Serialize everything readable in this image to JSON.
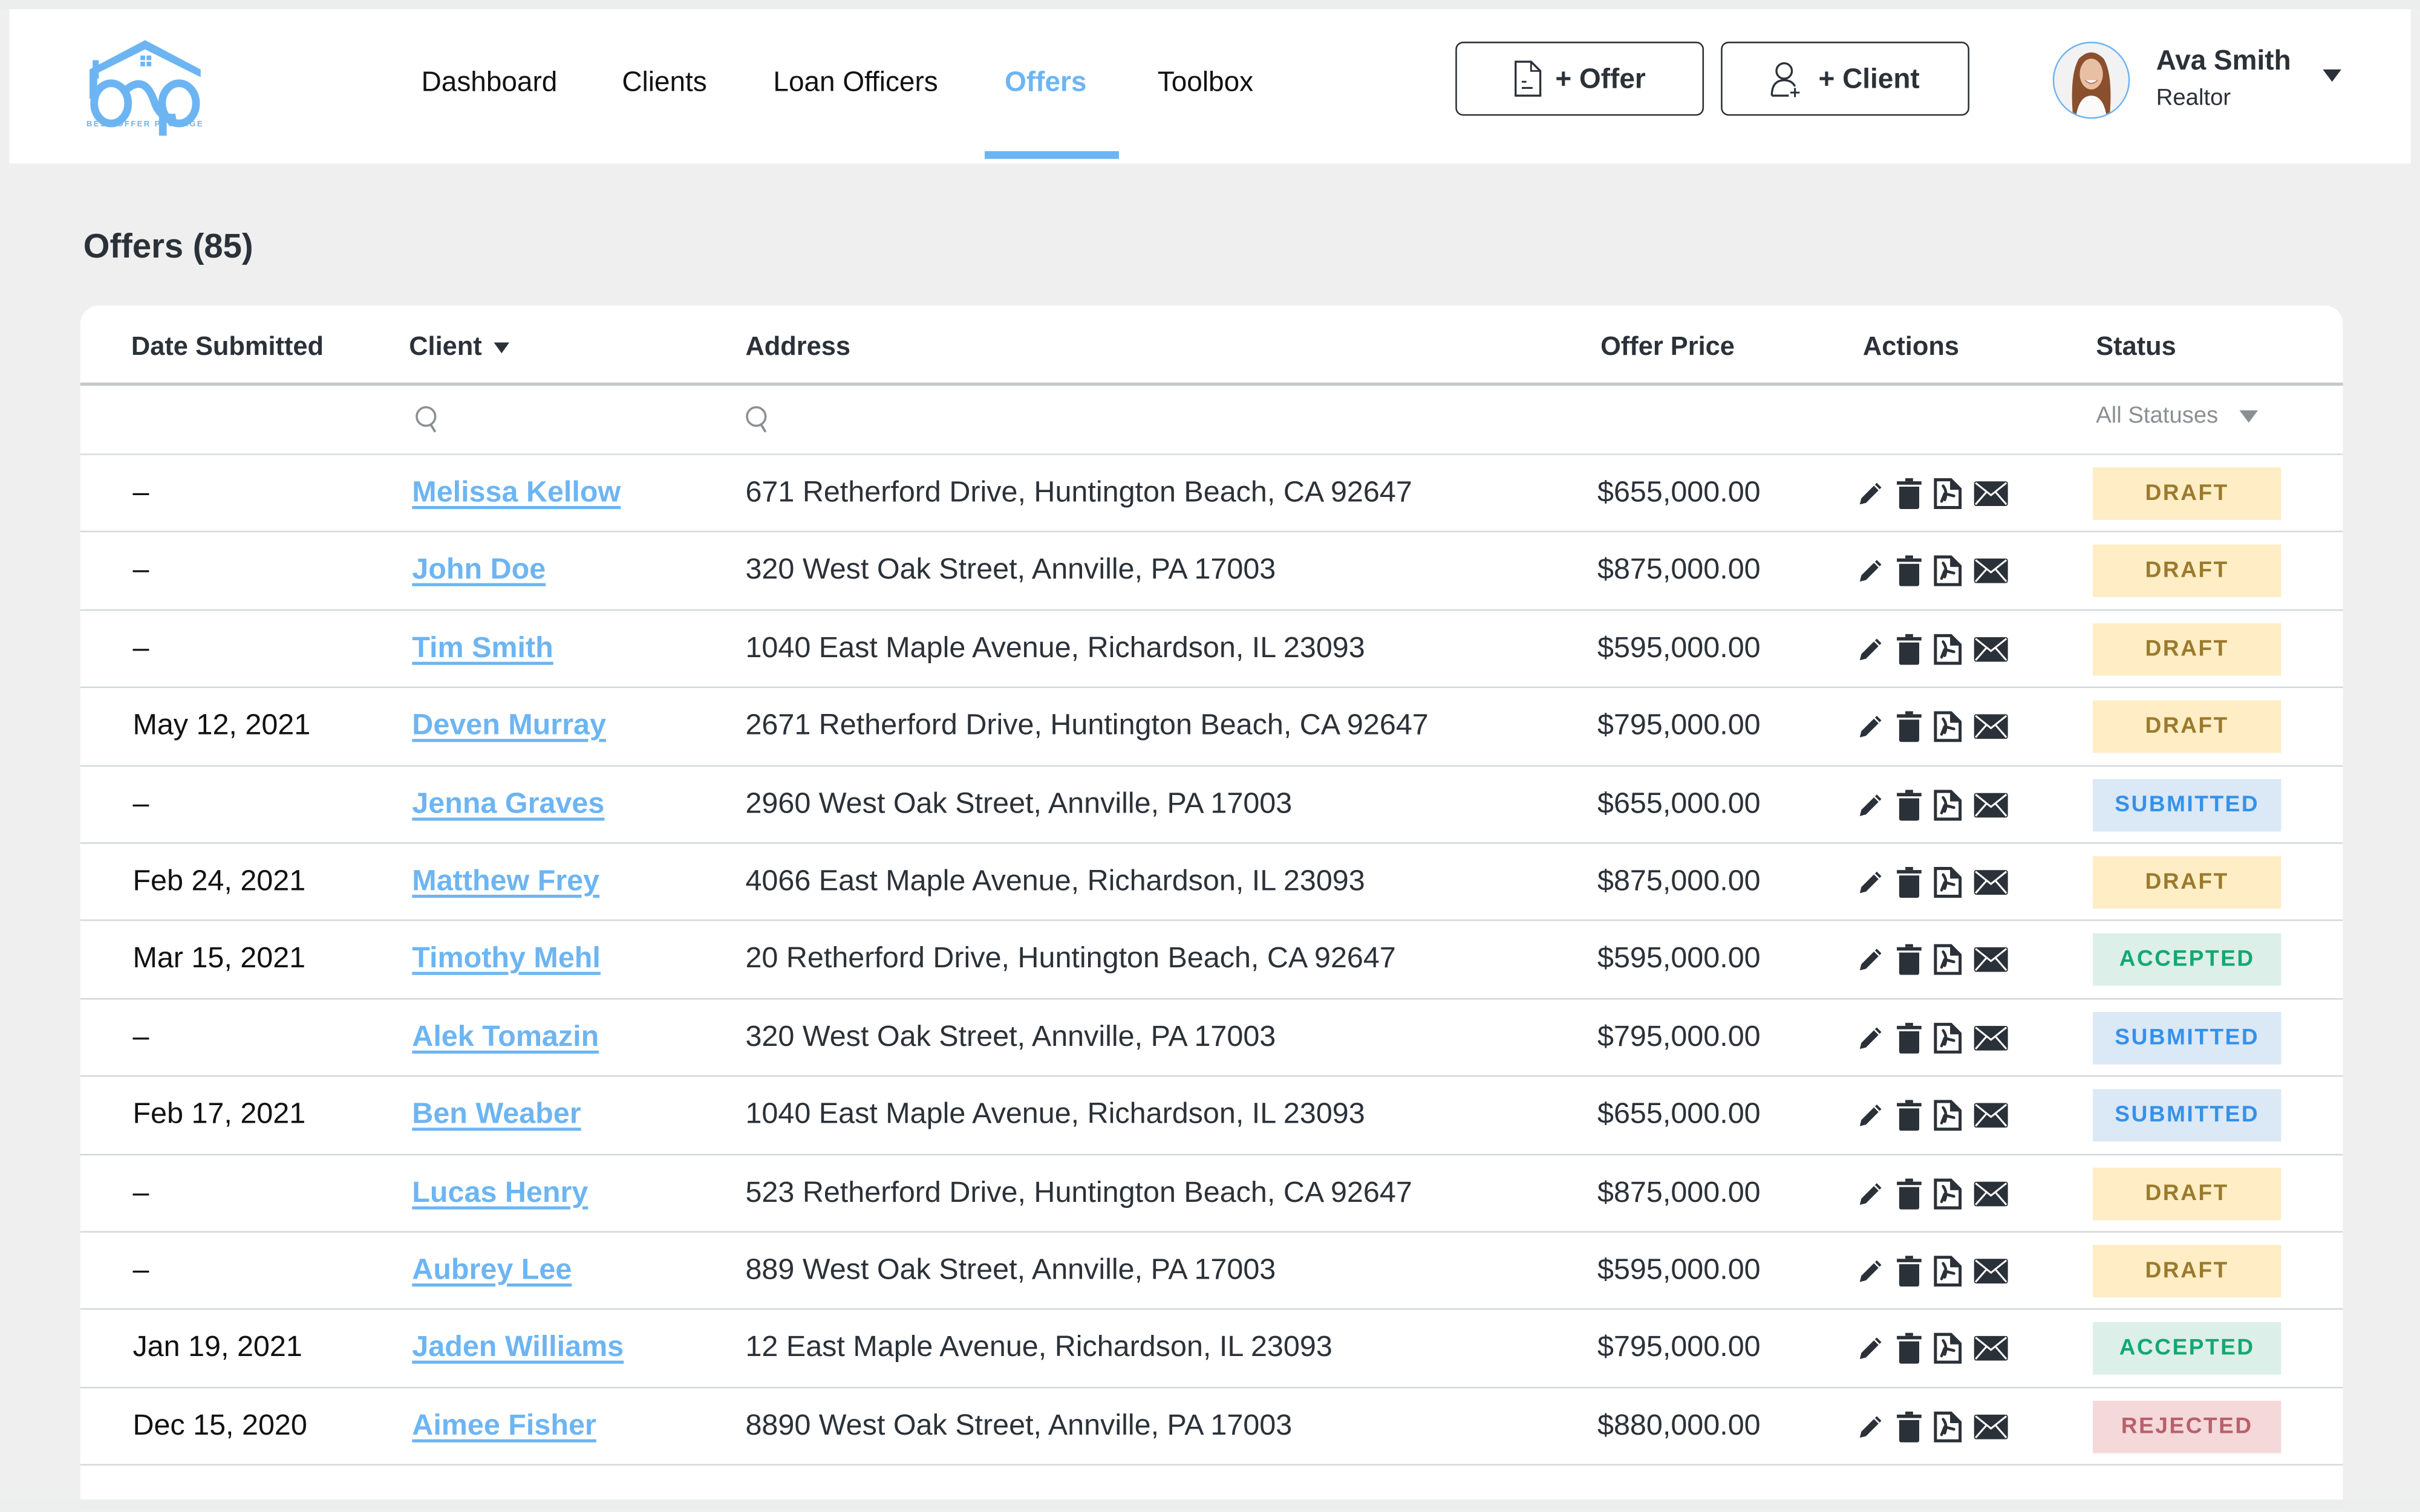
{
  "brand": {
    "logo_letters": "bop",
    "tagline": "BEST OFFER PACKAGE",
    "accent_color": "#6db5f2"
  },
  "nav": {
    "items": [
      {
        "label": "Dashboard",
        "active": false
      },
      {
        "label": "Clients",
        "active": false
      },
      {
        "label": "Loan Officers",
        "active": false
      },
      {
        "label": "Offers",
        "active": true
      },
      {
        "label": "Toolbox",
        "active": false
      }
    ]
  },
  "header_actions": {
    "add_offer": {
      "label": "+ Offer",
      "icon": "document-icon"
    },
    "add_client": {
      "label": "+ Client",
      "icon": "user-plus-icon"
    }
  },
  "user": {
    "name": "Ava Smith",
    "role": "Realtor",
    "avatar": "user-avatar-photo"
  },
  "page": {
    "title": "Offers (85)"
  },
  "table": {
    "columns": {
      "date": "Date Submitted",
      "client": "Client",
      "address": "Address",
      "price": "Offer Price",
      "actions": "Actions",
      "status": "Status"
    },
    "filters": {
      "client_search_placeholder": "",
      "address_search_placeholder": "",
      "status_selected": "All Statuses"
    },
    "action_icons": [
      "pencil-icon",
      "trash-icon",
      "pdf-icon",
      "envelope-icon"
    ],
    "status_styles": {
      "DRAFT": {
        "bg": "#feedc5",
        "fg": "#9b7a2c"
      },
      "SUBMITTED": {
        "bg": "#dbe8f5",
        "fg": "#3491ea"
      },
      "ACCEPTED": {
        "bg": "#dcefe8",
        "fg": "#13a872"
      },
      "REJECTED": {
        "bg": "#f5d8da",
        "fg": "#b8606b"
      }
    },
    "rows": [
      {
        "date": "–",
        "client": "Melissa Kellow",
        "address": "671 Retherford Drive, Huntington Beach, CA 92647",
        "price": "$655,000.00",
        "status": "DRAFT"
      },
      {
        "date": "–",
        "client": "John Doe",
        "address": "320 West Oak Street, Annville, PA 17003",
        "price": "$875,000.00",
        "status": "DRAFT"
      },
      {
        "date": "–",
        "client": "Tim Smith",
        "address": "1040 East Maple Avenue, Richardson, IL 23093",
        "price": "$595,000.00",
        "status": "DRAFT"
      },
      {
        "date": "May 12, 2021",
        "client": "Deven Murray",
        "address": "2671 Retherford Drive, Huntington Beach, CA 92647",
        "price": "$795,000.00",
        "status": "DRAFT"
      },
      {
        "date": "–",
        "client": "Jenna Graves",
        "address": "2960 West Oak Street, Annville, PA 17003",
        "price": "$655,000.00",
        "status": "SUBMITTED"
      },
      {
        "date": "Feb 24, 2021",
        "client": "Matthew Frey",
        "address": "4066 East Maple Avenue, Richardson, IL 23093",
        "price": "$875,000.00",
        "status": "DRAFT"
      },
      {
        "date": "Mar 15, 2021",
        "client": "Timothy Mehl",
        "address": "20 Retherford Drive, Huntington Beach, CA 92647",
        "price": "$595,000.00",
        "status": "ACCEPTED"
      },
      {
        "date": "–",
        "client": "Alek Tomazin",
        "address": "320 West Oak Street, Annville, PA 17003",
        "price": "$795,000.00",
        "status": "SUBMITTED"
      },
      {
        "date": "Feb 17, 2021",
        "client": "Ben Weaber",
        "address": "1040 East Maple Avenue, Richardson, IL 23093",
        "price": "$655,000.00",
        "status": "SUBMITTED"
      },
      {
        "date": "–",
        "client": "Lucas Henry",
        "address": "523 Retherford Drive, Huntington Beach, CA 92647",
        "price": "$875,000.00",
        "status": "DRAFT"
      },
      {
        "date": "–",
        "client": "Aubrey Lee",
        "address": "889 West Oak Street, Annville, PA 17003",
        "price": "$595,000.00",
        "status": "DRAFT"
      },
      {
        "date": "Jan 19, 2021",
        "client": "Jaden Williams",
        "address": "12 East Maple Avenue, Richardson, IL 23093",
        "price": "$795,000.00",
        "status": "ACCEPTED"
      },
      {
        "date": "Dec 15, 2020",
        "client": "Aimee Fisher",
        "address": "8890 West Oak Street, Annville, PA 17003",
        "price": "$880,000.00",
        "status": "REJECTED"
      }
    ]
  }
}
